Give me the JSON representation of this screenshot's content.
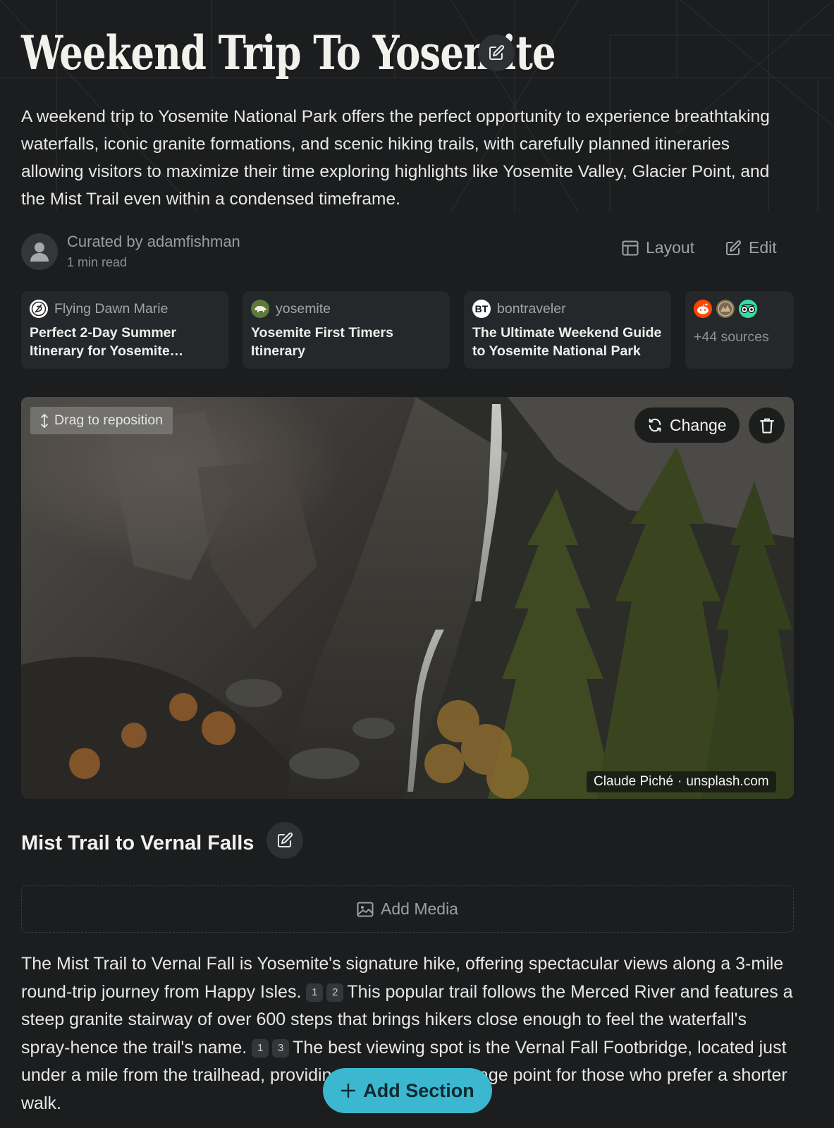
{
  "header": {
    "title": "Weekend Trip To Yosemite",
    "summary": "A weekend trip to Yosemite National Park offers the perfect opportunity to experience breathtaking waterfalls, iconic granite formations, and scenic hiking trails, with carefully planned itineraries allowing visitors to maximize their time exploring highlights like Yosemite Valley, Glacier Point, and the Mist Trail even within a condensed timeframe."
  },
  "author": {
    "curated_by": "Curated by adamfishman",
    "read_time": "1 min read"
  },
  "toolbar": {
    "layout_label": "Layout",
    "edit_label": "Edit"
  },
  "sources": [
    {
      "name": "Flying Dawn Marie",
      "title": "Perfect 2-Day Summer Itinerary for Yosemite…",
      "icon": "flying-dawn-logo"
    },
    {
      "name": "yosemite",
      "title": "Yosemite First Timers Itinerary",
      "icon": "yosemite-bear-logo"
    },
    {
      "name": "bontraveler",
      "title": "The Ultimate Weekend Guide to Yosemite National Park",
      "icon": "bt-logo",
      "icon_text": "BT"
    },
    {
      "more_count": "+44 sources",
      "icons": [
        "reddit-icon",
        "nps-icon",
        "tripadvisor-icon"
      ]
    }
  ],
  "hero": {
    "drag_label": "Drag to reposition",
    "change_label": "Change",
    "credit_author": "Claude Piché",
    "credit_separator": "·",
    "credit_site": "unsplash.com"
  },
  "section": {
    "title": "Mist Trail to Vernal Falls",
    "add_media_label": "Add Media",
    "body": {
      "p1": "The Mist Trail to Vernal Fall is Yosemite's signature hike, offering spectacular views along a 3-mile round-trip journey from Happy Isles.",
      "c1": "1",
      "c2": "2",
      "p2": "This popular trail follows the Merced River and features a steep granite stairway of over 600 steps that brings hikers close enough to feel the waterfall's spray-hence the trail's name.",
      "c3": "1",
      "c4": "3",
      "p3": "The best viewing spot is the Vernal Fall Footbridge, located just under a mile from the trailhead, providing an excellent vantage point for those who prefer a shorter walk."
    }
  },
  "fab": {
    "add_section_label": "Add Section"
  },
  "colors": {
    "background": "#1b1d1e",
    "card": "#25282a",
    "accent": "#3bb8cf"
  }
}
